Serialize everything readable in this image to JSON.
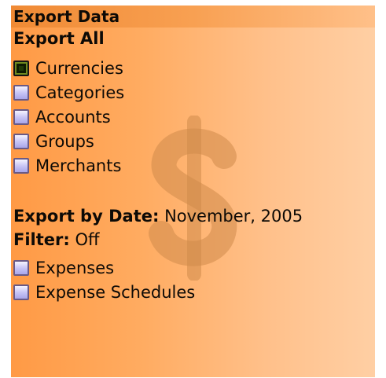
{
  "screen": {
    "title": "Export Data",
    "watermark_icon": "dollar-sign-icon",
    "colors": {
      "gradient_left": "#ff9a45",
      "gradient_right": "#ffcfa4",
      "checkbox_unchecked": "#c9c6f6",
      "checkbox_checked": "#1f3a07"
    }
  },
  "export_all": {
    "label": "Export All",
    "items": [
      {
        "label": "Currencies",
        "checked": true
      },
      {
        "label": "Categories",
        "checked": false
      },
      {
        "label": "Accounts",
        "checked": false
      },
      {
        "label": "Groups",
        "checked": false
      },
      {
        "label": "Merchants",
        "checked": false
      }
    ]
  },
  "export_by_date": {
    "label": "Export by Date:",
    "value": "November, 2005"
  },
  "filter": {
    "label": "Filter:",
    "value": "Off"
  },
  "date_items": [
    {
      "label": "Expenses",
      "checked": false
    },
    {
      "label": "Expense Schedules",
      "checked": false
    }
  ]
}
